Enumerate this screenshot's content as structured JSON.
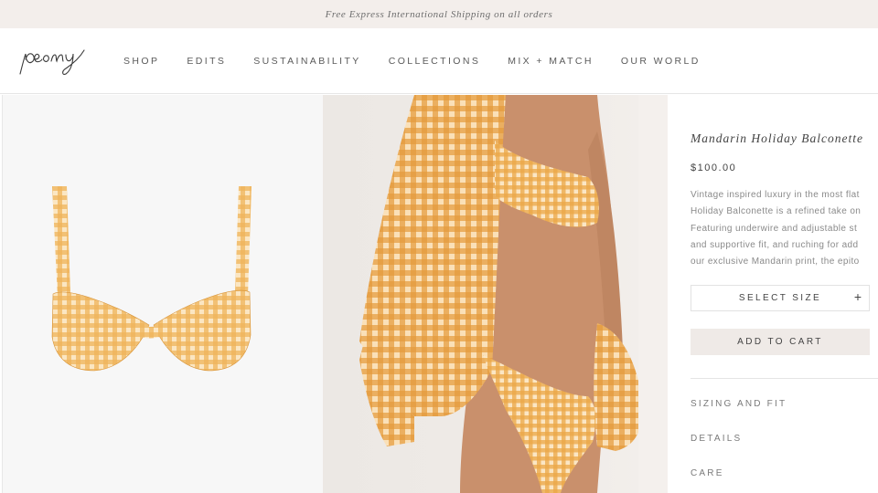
{
  "promo": {
    "text": "Free Express International Shipping on all orders"
  },
  "brand": {
    "logo_text": "peony"
  },
  "nav": {
    "items": [
      {
        "label": "SHOP"
      },
      {
        "label": "EDITS"
      },
      {
        "label": "SUSTAINABILITY"
      },
      {
        "label": "COLLECTIONS"
      },
      {
        "label": "MIX + MATCH"
      },
      {
        "label": "OUR WORLD"
      }
    ]
  },
  "product": {
    "title": "Mandarin Holiday Balconette",
    "price": "$100.00",
    "description_lines": [
      "Vintage inspired luxury in the most flat",
      "Holiday Balconette is a refined take on",
      "Featuring underwire and adjustable st",
      "and supportive fit, and ruching for add",
      "our exclusive Mandarin print, the epito"
    ],
    "select_size_label": "SELECT SIZE",
    "select_size_icon": "+",
    "add_to_cart_label": "ADD TO CART",
    "accordions": [
      {
        "label": "SIZING AND FIT"
      },
      {
        "label": "DETAILS"
      },
      {
        "label": "CARE"
      }
    ]
  },
  "colors": {
    "promo_bg": "#f3eeeb",
    "gingham_orange": "#e8a33c",
    "gingham_light": "#fbe6c2",
    "button_bg": "#efeae7"
  }
}
